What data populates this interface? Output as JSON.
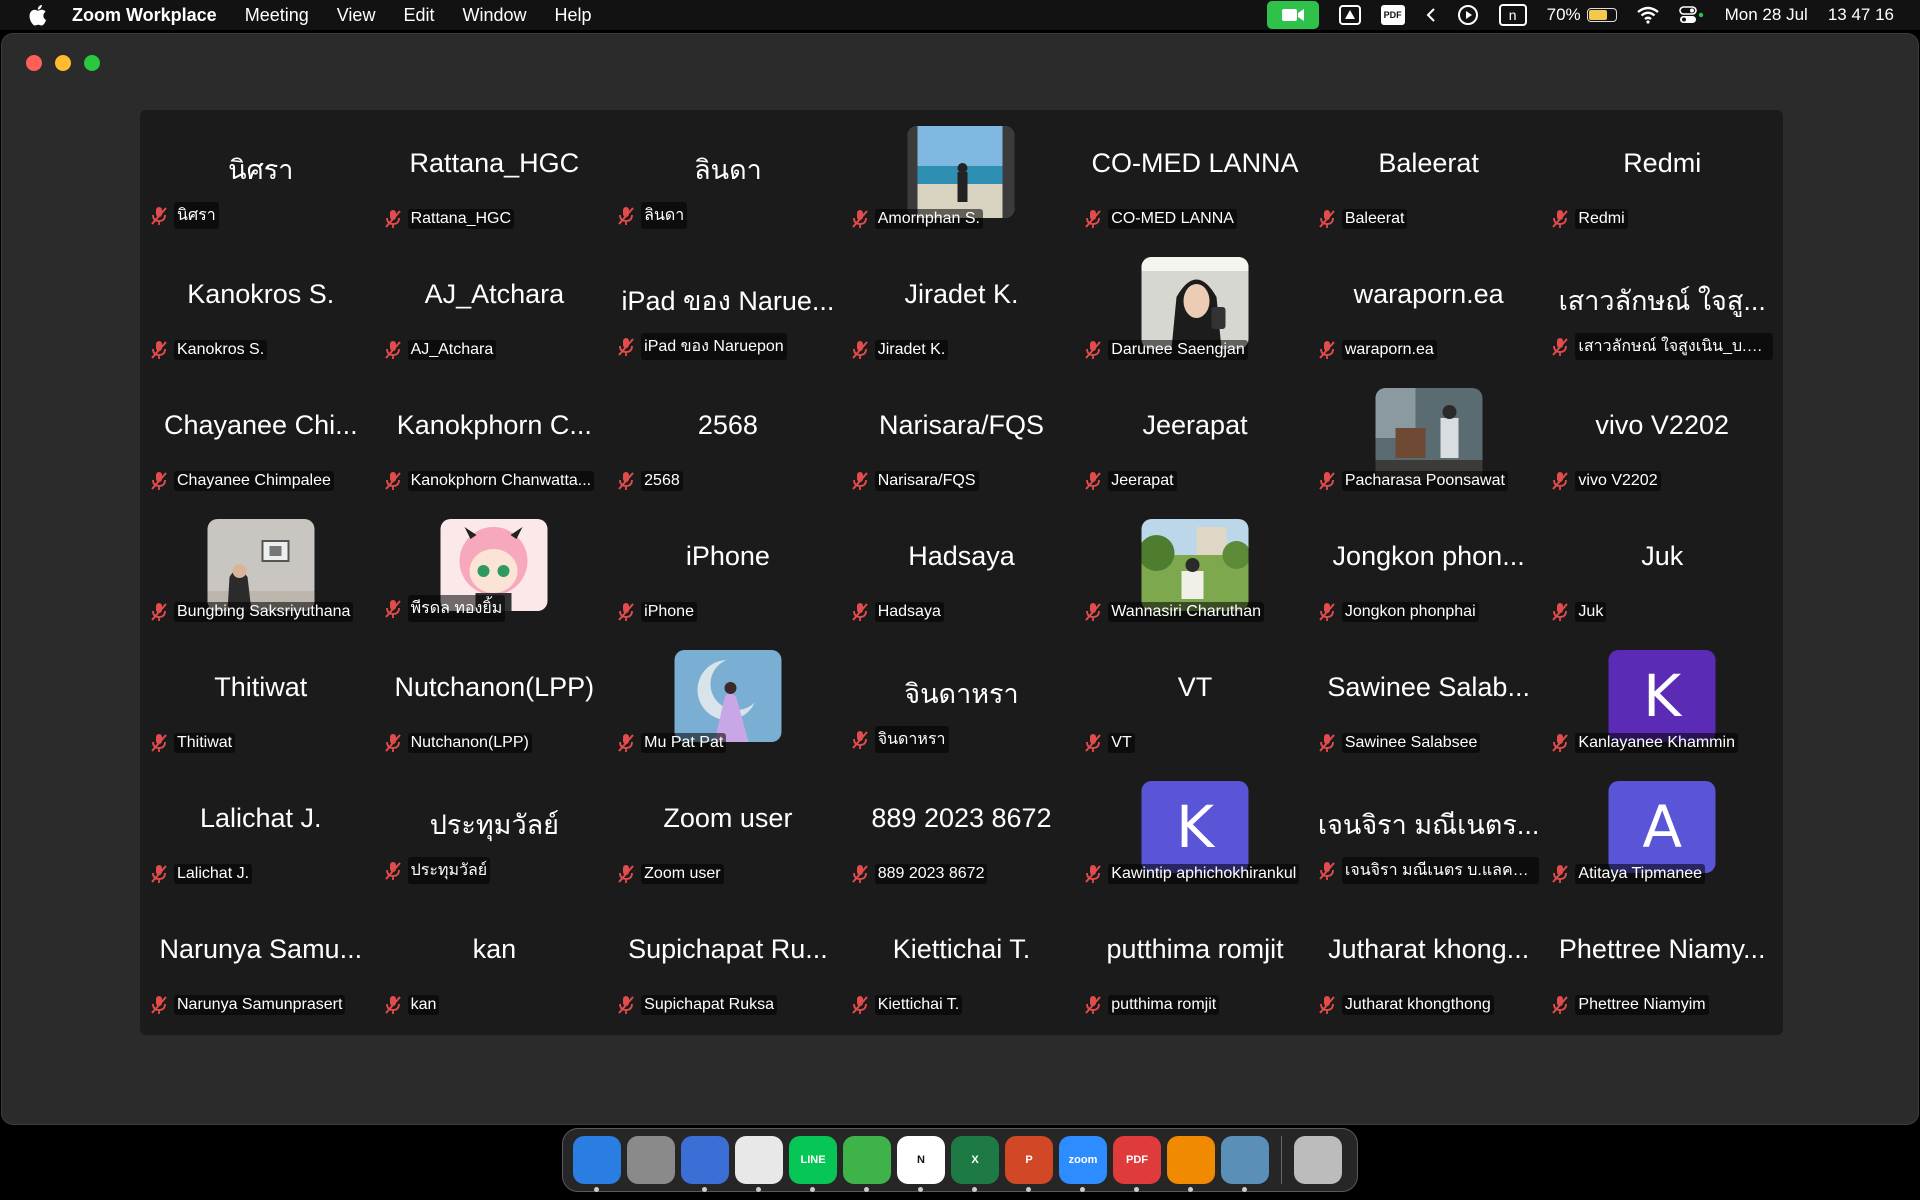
{
  "menubar": {
    "app_name": "Zoom Workplace",
    "menus": [
      "Meeting",
      "View",
      "Edit",
      "Window",
      "Help"
    ],
    "battery_percent": "70%",
    "battery_level": 0.7,
    "date": "Mon 28 Jul",
    "time": "13 47 16",
    "icons": [
      "apple-icon",
      "zoom-camera-icon",
      "drive-icon",
      "pdf-icon",
      "chevron-left-icon",
      "play-icon",
      "n-box-icon",
      "battery-icon",
      "wifi-icon",
      "control-center-icon"
    ]
  },
  "gallery": {
    "tiles": [
      {
        "name": "นิศรา",
        "label": "นิศรา",
        "avatar": null
      },
      {
        "name": "Rattana_HGC",
        "label": "Rattana_HGC",
        "avatar": null
      },
      {
        "name": "ลินดา",
        "label": "ลินดา",
        "avatar": null
      },
      {
        "name": "",
        "label": "Amornphan S.",
        "avatar": "photo-beach"
      },
      {
        "name": "CO-MED LANNA",
        "label": "CO-MED LANNA",
        "avatar": null
      },
      {
        "name": "Baleerat",
        "label": "Baleerat",
        "avatar": null
      },
      {
        "name": "Redmi",
        "label": "Redmi",
        "avatar": null
      },
      {
        "name": "Kanokros S.",
        "label": "Kanokros S.",
        "avatar": null
      },
      {
        "name": "AJ_Atchara",
        "label": "AJ_Atchara",
        "avatar": null
      },
      {
        "name": "iPad ของ Narue...",
        "label": "iPad ของ Naruepon",
        "avatar": null
      },
      {
        "name": "Jiradet K.",
        "label": "Jiradet K.",
        "avatar": null
      },
      {
        "name": "",
        "label": "Darunee Saengjan",
        "avatar": "photo-selfie"
      },
      {
        "name": "waraporn.ea",
        "label": "waraporn.ea",
        "avatar": null
      },
      {
        "name": "เสาวลักษณ์ ใจสู...",
        "label": "เสาวลักษณ์ ใจสูงเนิน_บ.ไท...",
        "avatar": null
      },
      {
        "name": "Chayanee Chi...",
        "label": "Chayanee Chimpalee",
        "avatar": null
      },
      {
        "name": "Kanokphorn C...",
        "label": "Kanokphorn Chanwatta...",
        "avatar": null
      },
      {
        "name": "2568",
        "label": "2568",
        "avatar": null
      },
      {
        "name": "Narisara/FQS",
        "label": "Narisara/FQS",
        "avatar": null
      },
      {
        "name": "Jeerapat",
        "label": "Jeerapat",
        "avatar": null
      },
      {
        "name": "",
        "label": "Pacharasa  Poonsawat",
        "avatar": "photo-chair"
      },
      {
        "name": "vivo V2202",
        "label": "vivo V2202",
        "avatar": null
      },
      {
        "name": "",
        "label": "Bungbing Saksriyuthana",
        "avatar": "photo-room"
      },
      {
        "name": "",
        "label": "พีรดล ทองยิ้ม",
        "avatar": "photo-anime"
      },
      {
        "name": "iPhone",
        "label": "iPhone",
        "avatar": null
      },
      {
        "name": "Hadsaya",
        "label": "Hadsaya",
        "avatar": null
      },
      {
        "name": "",
        "label": "Wannasiri Charuthan",
        "avatar": "photo-park"
      },
      {
        "name": "Jongkon phon...",
        "label": "Jongkon phonphai",
        "avatar": null
      },
      {
        "name": "Juk",
        "label": "Juk",
        "avatar": null
      },
      {
        "name": "Thitiwat",
        "label": "Thitiwat",
        "avatar": null
      },
      {
        "name": "Nutchanon(LPP)",
        "label": "Nutchanon(LPP)",
        "avatar": null
      },
      {
        "name": "",
        "label": "Mu Pat Pat",
        "avatar": "photo-moon"
      },
      {
        "name": "จินดาหรา",
        "label": "จินดาหรา",
        "avatar": null
      },
      {
        "name": "VT",
        "label": "VT",
        "avatar": null
      },
      {
        "name": "Sawinee Salab...",
        "label": "Sawinee Salabsee",
        "avatar": null
      },
      {
        "name": "",
        "label": "Kanlayanee Khammin",
        "avatar": "letter",
        "letter": "K",
        "color": "#5b2bb5"
      },
      {
        "name": "Lalichat J.",
        "label": "Lalichat J.",
        "avatar": null
      },
      {
        "name": "ประทุมวัลย์",
        "label": "ประทุมวัลย์",
        "avatar": null
      },
      {
        "name": "Zoom user",
        "label": "Zoom user",
        "avatar": null
      },
      {
        "name": "889 2023 8672",
        "label": "889 2023 8672",
        "avatar": null
      },
      {
        "name": "",
        "label": "Kawintip aphichokhirankul",
        "avatar": "letter",
        "letter": "K",
        "color": "#5a55d6"
      },
      {
        "name": "เจนจิรา มณีเนตร...",
        "label": "เจนจิรา มณีเนตร บ.แลคตา...",
        "avatar": null
      },
      {
        "name": "",
        "label": "Atitaya Tipmanee",
        "avatar": "letter",
        "letter": "A",
        "color": "#5a55d6"
      },
      {
        "name": "Narunya Samu...",
        "label": "Narunya Samunprasert",
        "avatar": null
      },
      {
        "name": "kan",
        "label": "kan",
        "avatar": null
      },
      {
        "name": "Supichapat Ru...",
        "label": "Supichapat Ruksa",
        "avatar": null
      },
      {
        "name": "Kiettichai T.",
        "label": "Kiettichai T.",
        "avatar": null
      },
      {
        "name": "putthima romjit",
        "label": "putthima romjit",
        "avatar": null
      },
      {
        "name": "Jutharat khong...",
        "label": "Jutharat khongthong",
        "avatar": null
      },
      {
        "name": "Phettree Niamy...",
        "label": "Phettree Niamyim",
        "avatar": null
      }
    ]
  },
  "dock": {
    "items": [
      {
        "name": "finder-icon",
        "text": "",
        "color": "#2a7de1",
        "running": true
      },
      {
        "name": "launchpad-icon",
        "text": "",
        "color": "#8a8a8a",
        "running": false
      },
      {
        "name": "firefox-icon",
        "text": "",
        "color": "#3b6fd6",
        "running": true
      },
      {
        "name": "chrome-icon",
        "text": "",
        "color": "#e8e8e8",
        "running": true
      },
      {
        "name": "line-icon",
        "text": "LINE",
        "color": "#06c755",
        "running": true
      },
      {
        "name": "numbers-icon",
        "text": "",
        "color": "#3db34a",
        "running": true
      },
      {
        "name": "notion-icon",
        "text": "N",
        "color": "#ffffff",
        "running": true
      },
      {
        "name": "excel-icon",
        "text": "X",
        "color": "#1d7a45",
        "running": true
      },
      {
        "name": "powerpoint-icon",
        "text": "P",
        "color": "#d24726",
        "running": true
      },
      {
        "name": "zoom-icon",
        "text": "zoom",
        "color": "#2d8cff",
        "running": true
      },
      {
        "name": "pdf-expert-icon",
        "text": "PDF",
        "color": "#e03b3b",
        "running": true
      },
      {
        "name": "vlc-icon",
        "text": "",
        "color": "#f08a00",
        "running": true
      },
      {
        "name": "quicktime-icon",
        "text": "",
        "color": "#5a8fb8",
        "running": true
      },
      {
        "name": "trash-icon",
        "text": "",
        "color": "#bcbcbc",
        "running": false
      }
    ]
  }
}
